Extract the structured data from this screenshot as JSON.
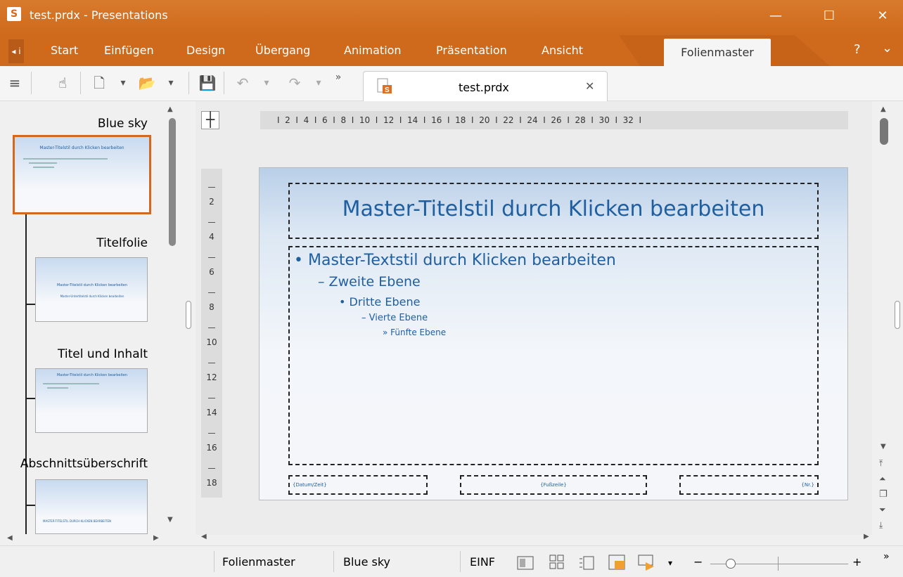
{
  "window": {
    "app_icon": "S",
    "title": "test.prdx - Presentations",
    "controls": {
      "minimize": "—",
      "maximize": "☐",
      "close": "✕"
    }
  },
  "ribbon": {
    "nav_left": "◂ i",
    "tabs": [
      "Start",
      "Einfügen",
      "Design",
      "Übergang",
      "Animation",
      "Präsentation",
      "Ansicht"
    ],
    "active_tab": "Folienmaster",
    "help": "?",
    "collapse": "⌄"
  },
  "toolbar": {
    "menu_icon": "≡",
    "hand_icon": "☝",
    "new_icon": "🗋",
    "dropdown": "▾",
    "open_icon": "📂",
    "save_icon": "💾",
    "undo_icon": "↶",
    "redo_icon": "↷",
    "more": "»"
  },
  "document_tab": {
    "name": "test.prdx",
    "close": "✕"
  },
  "slide_panel": {
    "items": [
      {
        "label": "Blue sky",
        "selected": true
      },
      {
        "label": "Titelfolie",
        "selected": false
      },
      {
        "label": "Titel und Inhalt",
        "selected": false
      },
      {
        "label": "Abschnittsüberschrift",
        "selected": false
      }
    ],
    "thumb_texts": {
      "blue_sky_title": "Master-Titelstil durch Klicken bearbeiten",
      "titelfolie_title": "Master-Titelstil durch Klicken bearbeiten",
      "titelfolie_sub": "Master-Untertitelstil durch Klicken bearbeiten",
      "inhalt_title": "Master-Titelstil durch Klicken bearbeiten",
      "abschnitt_title": "MASTER-TITELSTIL DURCH KLICKEN BEARBEITEN"
    }
  },
  "rulers": {
    "horizontal": "I  2  I  4  I  6  I  8  I  10  I  12  I  14  I  16  I  18  I  20  I  22  I  24  I  26  I  28  I  30  I  32  I",
    "vertical": [
      "2",
      "4",
      "6",
      "8",
      "10",
      "12",
      "14",
      "16",
      "18"
    ]
  },
  "slide": {
    "title": "Master-Titelstil durch Klicken bearbeiten",
    "level1": "Master-Textstil durch Klicken bearbeiten",
    "level2": "Zweite Ebene",
    "level3": "Dritte Ebene",
    "level4": "Vierte Ebene",
    "level5": "Fünfte Ebene",
    "footer_date": "{Datum/Zeit}",
    "footer_text": "{Fußzeile}",
    "footer_num": "{Nr.}"
  },
  "statusbar": {
    "mode": "Folienmaster",
    "master": "Blue sky",
    "insert": "EINF",
    "zoom_minus": "−",
    "zoom_plus": "+",
    "zoom_fraction": 0.15,
    "more": "»"
  },
  "colors": {
    "accent": "#cf6a1c",
    "slide_text": "#1f5fa0"
  }
}
